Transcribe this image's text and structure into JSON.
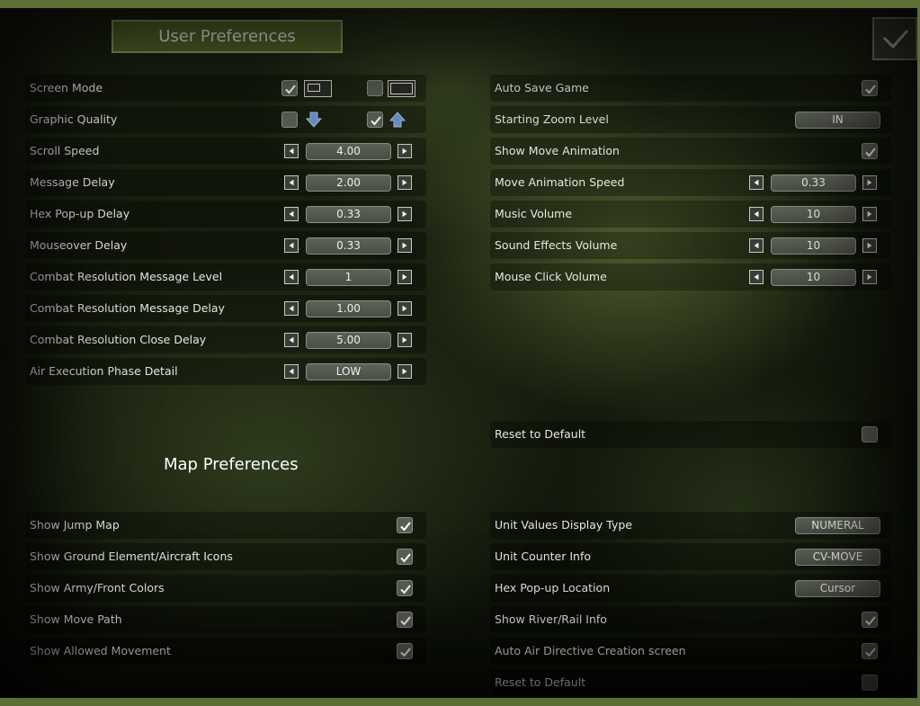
{
  "header": {
    "title": "User Preferences"
  },
  "map_header": {
    "title": "Map Preferences"
  },
  "icons": {
    "confirm": "checkmark-icon",
    "left": "arrow-left-icon",
    "right": "arrow-right-icon",
    "quality_low": "arrow-down-icon",
    "quality_high": "arrow-up-icon",
    "windowed": "windowed-icon",
    "fullscreen": "fullscreen-icon"
  },
  "colors": {
    "accent": "#5c6c2e",
    "frame": "#5d6e36",
    "check_bg": "#5a5f55",
    "quality_arrow": "#6f93c9"
  },
  "left": {
    "screen_mode": {
      "label": "Screen Mode",
      "windowed_checked": true,
      "fullscreen_checked": false
    },
    "graphic_quality": {
      "label": "Graphic Quality",
      "low_checked": false,
      "high_checked": true
    },
    "scroll_speed": {
      "label": "Scroll Speed",
      "value": "4.00"
    },
    "message_delay": {
      "label": "Message Delay",
      "value": "2.00"
    },
    "hex_popup_delay": {
      "label": "Hex Pop-up Delay",
      "value": "0.33"
    },
    "mouseover_delay": {
      "label": "Mouseover Delay",
      "value": "0.33"
    },
    "combat_msg_level": {
      "label": "Combat Resolution Message Level",
      "value": "1"
    },
    "combat_msg_delay": {
      "label": "Combat Resolution Message Delay",
      "value": "1.00"
    },
    "combat_close_delay": {
      "label": "Combat Resolution Close Delay",
      "value": "5.00"
    },
    "air_exec_detail": {
      "label": "Air Execution Phase Detail",
      "value": "LOW"
    }
  },
  "right": {
    "auto_save": {
      "label": "Auto Save Game",
      "checked": true
    },
    "starting_zoom": {
      "label": "Starting Zoom Level",
      "value": "IN"
    },
    "show_move_anim": {
      "label": "Show Move Animation",
      "checked": true
    },
    "move_anim_speed": {
      "label": "Move Animation Speed",
      "value": "0.33"
    },
    "music_volume": {
      "label": "Music Volume",
      "value": "10"
    },
    "sfx_volume": {
      "label": "Sound Effects Volume",
      "value": "10"
    },
    "mouse_click_volume": {
      "label": "Mouse Click Volume",
      "value": "10"
    },
    "reset": {
      "label": "Reset to Default",
      "checked": false
    }
  },
  "map_left": {
    "jump_map": {
      "label": "Show Jump Map",
      "checked": true
    },
    "ground_icons": {
      "label": "Show Ground Element/Aircraft Icons",
      "checked": true
    },
    "army_colors": {
      "label": "Show Army/Front Colors",
      "checked": true
    },
    "move_path": {
      "label": "Show Move Path",
      "checked": true
    },
    "allowed_movement": {
      "label": "Show Allowed Movement",
      "checked": true
    }
  },
  "map_right": {
    "unit_values": {
      "label": "Unit Values Display Type",
      "value": "NUMERAL"
    },
    "unit_counter": {
      "label": "Unit Counter Info",
      "value": "CV-MOVE"
    },
    "hex_popup_loc": {
      "label": "Hex Pop-up Location",
      "value": "Cursor"
    },
    "river_rail": {
      "label": "Show River/Rail Info",
      "checked": true
    },
    "auto_air": {
      "label": "Auto Air Directive Creation screen",
      "checked": true
    },
    "reset": {
      "label": "Reset to Default",
      "checked": false
    }
  }
}
